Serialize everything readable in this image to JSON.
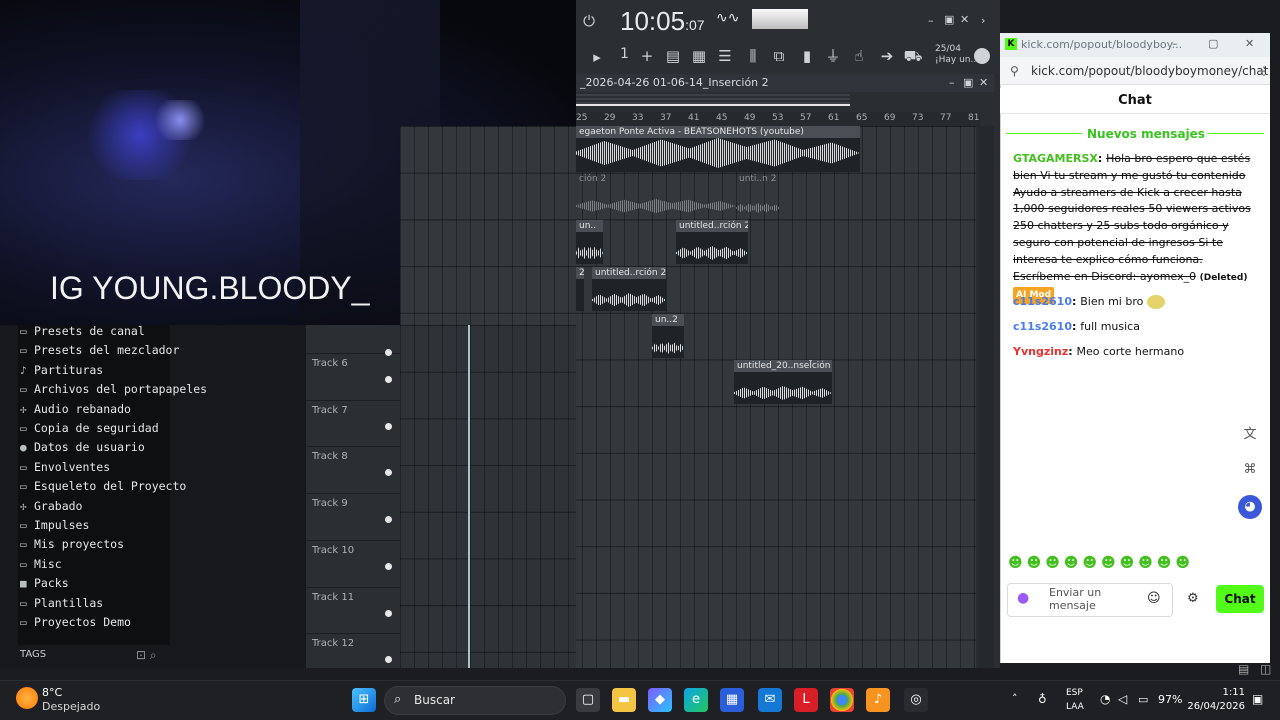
{
  "webcam": {
    "overlay_text": "IG YOUNG.BLOODY_"
  },
  "daw": {
    "clock": {
      "main": "10:05",
      "sub": "07"
    },
    "pattern_number": "1",
    "date_widget": {
      "line1": "25/04",
      "line2": "¡Hay un..."
    },
    "playlist_title": "_2026-04-26 01-06-14_Inserción 2",
    "ruler": [
      "25",
      "29",
      "33",
      "37",
      "41",
      "45",
      "49",
      "53",
      "57",
      "61",
      "65",
      "69",
      "73",
      "77",
      "81"
    ],
    "clips": [
      {
        "label": "egaeton Ponte Activa - BEATSONEHOTS (youtube)"
      },
      {
        "label": "ción 2"
      },
      {
        "label": "unti..n 2"
      },
      {
        "label": "un.."
      },
      {
        "label": "untitled..rción 2"
      },
      {
        "label": "2"
      },
      {
        "label": "untitled..rción 2"
      },
      {
        "label": "un..2"
      },
      {
        "label": "untitled_20..nsel̃ción 2"
      }
    ],
    "tracks": [
      "Track 6",
      "Track 7",
      "Track 8",
      "Track 9",
      "Track 10",
      "Track 11",
      "Track 12"
    ]
  },
  "browser": {
    "items": [
      {
        "icon": "folder",
        "label": "Presets de canal"
      },
      {
        "icon": "folder",
        "label": "Presets del mezclador"
      },
      {
        "icon": "note",
        "label": "Partituras"
      },
      {
        "icon": "folder",
        "label": "Archivos del portapapeles"
      },
      {
        "icon": "wave",
        "label": "Audio rebanado"
      },
      {
        "icon": "folder",
        "label": "Copia de seguridad"
      },
      {
        "icon": "user",
        "label": "Datos de usuario"
      },
      {
        "icon": "folder",
        "label": "Envolventes"
      },
      {
        "icon": "folder",
        "label": "Esqueleto del Proyecto"
      },
      {
        "icon": "wave",
        "label": "Grabado"
      },
      {
        "icon": "folder",
        "label": "Impulses"
      },
      {
        "icon": "folder",
        "label": "Mis proyectos"
      },
      {
        "icon": "folder",
        "label": "Misc"
      },
      {
        "icon": "box",
        "label": "Packs"
      },
      {
        "icon": "folder",
        "label": "Plantillas"
      },
      {
        "icon": "folder",
        "label": "Proyectos Demo"
      }
    ],
    "tags_label": "TAGS"
  },
  "chat": {
    "tab_title": "kick.com/popout/bloodyboy...",
    "url": "kick.com/popout/bloodyboymoney/chat",
    "title": "Chat",
    "new_messages": "Nuevos mensajes",
    "messages": [
      {
        "user": "GTAGAMERSX",
        "user_color": "#43c01d",
        "text": "Hola bro espero que estés bien Vi tu stream y me gustó tu contenido Ayudo a streamers de Kick a crecer hasta 1,000 seguidores reales 50 viewers activos 250 chatters y 25 subs todo orgánico y seguro con potencial de ingresos Si te interesa te explico cómo funciona. Escríbeme en Discord: ayomex_0",
        "deleted": "(Deleted)",
        "badge": "AI Mod",
        "strike": true
      },
      {
        "user": "c11s2610",
        "user_color": "#4b7bec",
        "text": "Bien mi bro"
      },
      {
        "user": "c11s2610",
        "user_color": "#4b7bec",
        "text": "full musica"
      },
      {
        "user": "Yvngzinz",
        "user_color": "#e8312f",
        "text": "Meo corte hermano"
      }
    ],
    "input_placeholder": "Enviar un mensaje",
    "send_label": "Chat"
  },
  "taskbar": {
    "temp": "8°C",
    "weather": "Despejado",
    "search": "Buscar",
    "lang1": "ESP",
    "lang2": "LAA",
    "battery": "97%",
    "time": "1:11",
    "date": "26/04/2026"
  }
}
